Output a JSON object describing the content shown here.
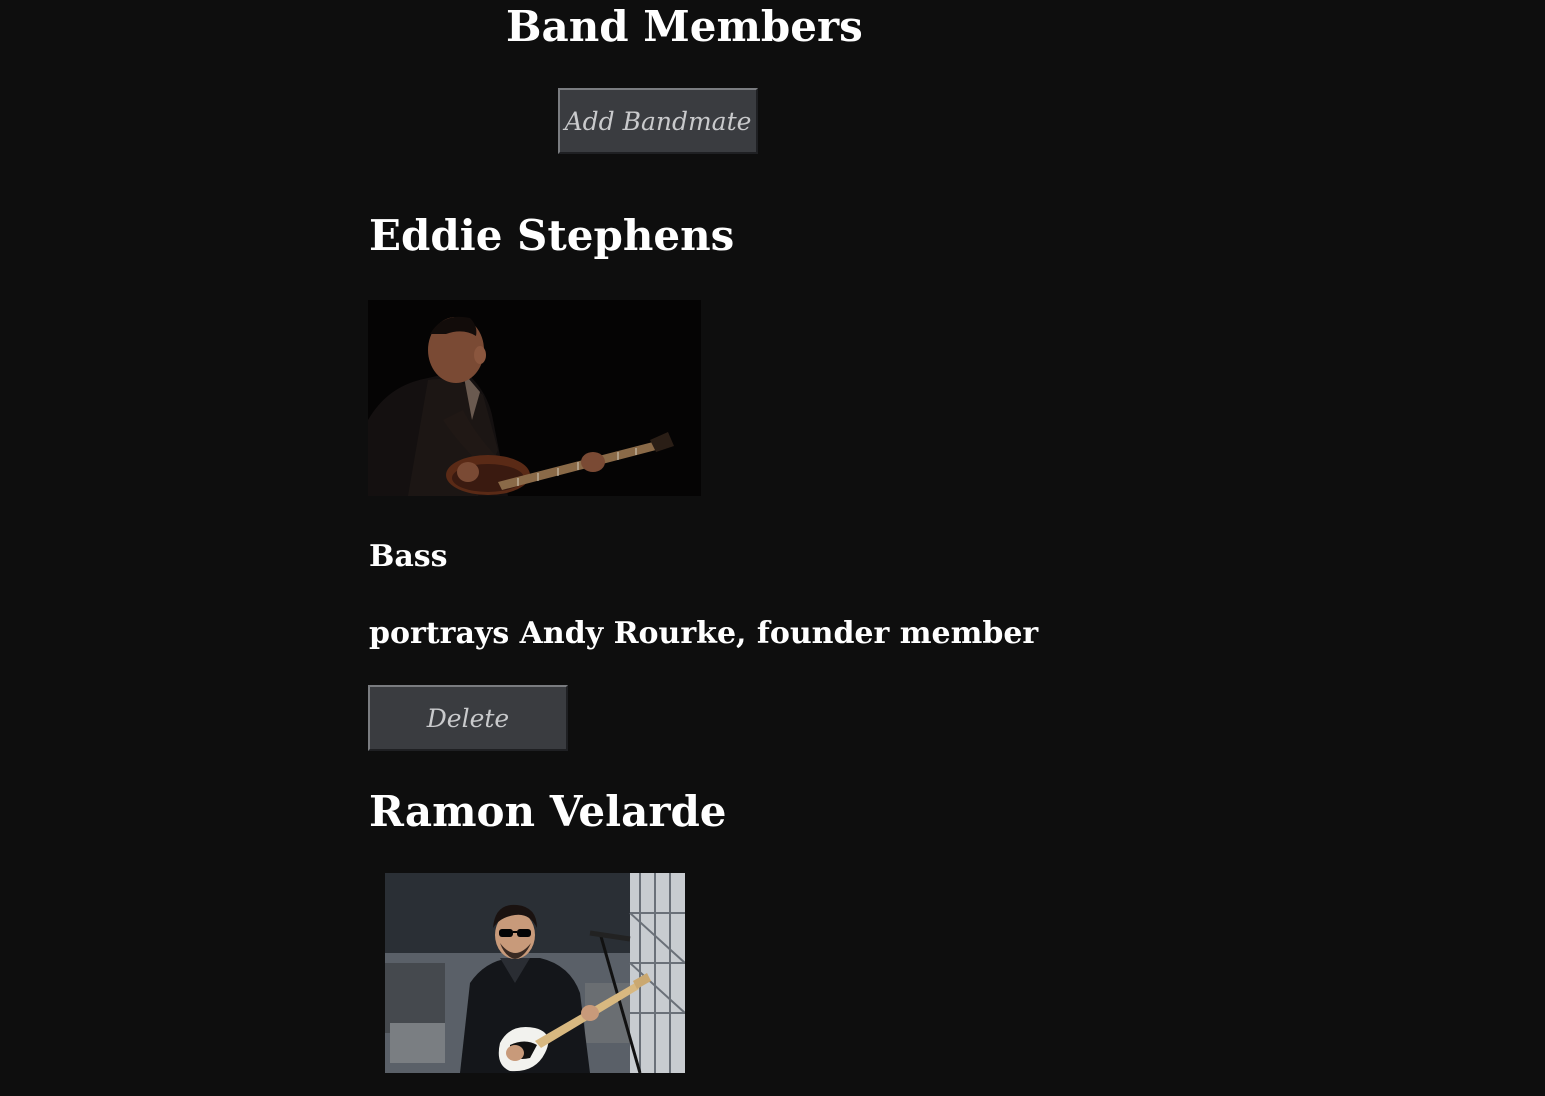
{
  "header": {
    "title": "Band Members",
    "add_label": "Add Bandmate"
  },
  "members": [
    {
      "name": "Eddie Stephens",
      "photo_icon": "bassist-photo",
      "instrument": "Bass",
      "description": "portrays Andy Rourke, founder member",
      "delete_label": "Delete"
    },
    {
      "name": "Ramon Velarde",
      "photo_icon": "guitarist-photo"
    }
  ],
  "colors": {
    "background": "#0e0e0e",
    "text": "#ffffff",
    "button_bg": "#3a3c40",
    "button_text": "#c9cacc"
  }
}
